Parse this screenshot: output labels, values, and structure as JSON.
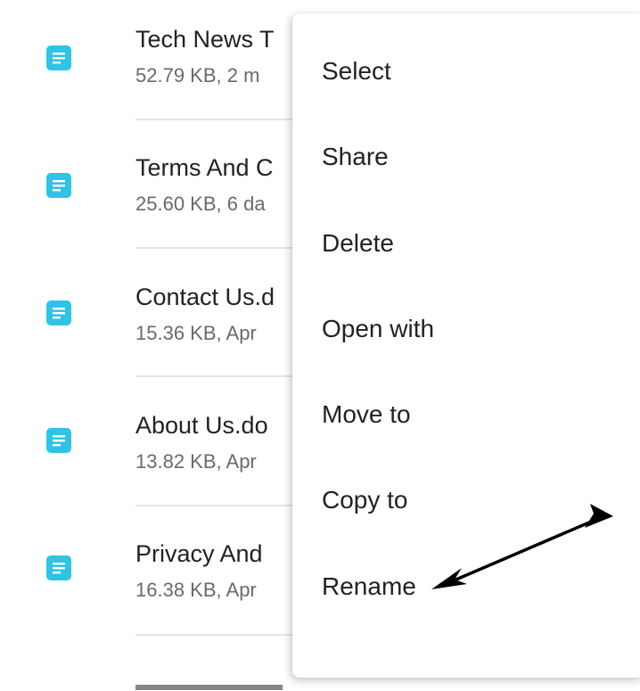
{
  "files": [
    {
      "name": "Tech News T",
      "meta": "52.79 KB, 2 m",
      "icon": "document-icon"
    },
    {
      "name": "Terms And C",
      "meta": "25.60 KB, 6 da",
      "icon": "document-icon"
    },
    {
      "name": "Contact Us.d",
      "meta": "15.36 KB, Apr",
      "icon": "document-icon"
    },
    {
      "name": "About Us.do",
      "meta": "13.82 KB, Apr",
      "icon": "document-icon"
    },
    {
      "name": "Privacy And",
      "meta": "16.38 KB, Apr",
      "icon": "document-icon"
    }
  ],
  "context_menu": {
    "items": [
      "Select",
      "Share",
      "Delete",
      "Open with",
      "Move to",
      "Copy to",
      "Rename"
    ]
  },
  "colors": {
    "icon_accent": "#2fc3e6",
    "annotation_arrow": "#000000"
  }
}
